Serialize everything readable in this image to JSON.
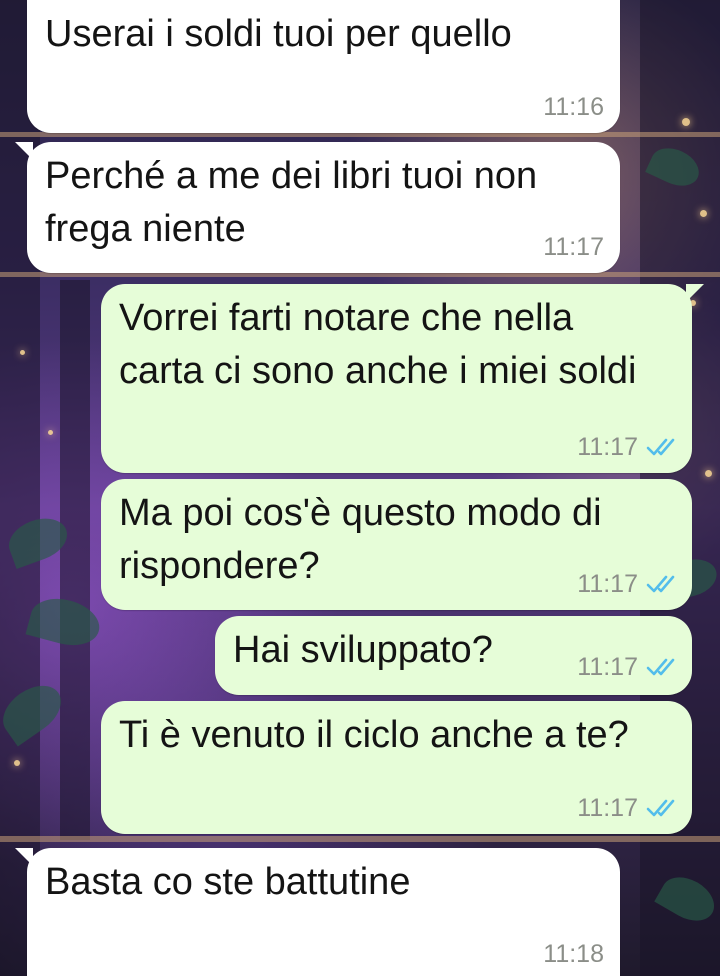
{
  "messages": [
    {
      "text": "Userai i soldi tuoi per quello",
      "time": "11:16",
      "direction": "incoming"
    },
    {
      "text": "Perché a me dei libri tuoi non frega niente",
      "time": "11:17",
      "direction": "incoming"
    },
    {
      "text": "Vorrei farti notare che nella carta ci sono anche i miei soldi",
      "time": "11:17",
      "direction": "outgoing",
      "status": "read"
    },
    {
      "text": "Ma poi cos'è questo modo di rispondere?",
      "time": "11:17",
      "direction": "outgoing",
      "status": "read"
    },
    {
      "text": "Hai sviluppato?",
      "time": "11:17",
      "direction": "outgoing",
      "status": "read"
    },
    {
      "text": "Ti è venuto il ciclo anche a te?",
      "time": "11:17",
      "direction": "outgoing",
      "status": "read"
    },
    {
      "text": "Basta co ste battutine",
      "time": "11:18",
      "direction": "incoming"
    }
  ],
  "colors": {
    "incoming_bubble": "#ffffff",
    "outgoing_bubble": "#e6fdd8",
    "read_ticks": "#53bdeb",
    "timestamp": "#8b8e88"
  },
  "icons": {
    "read_receipt": "double-check-icon"
  }
}
